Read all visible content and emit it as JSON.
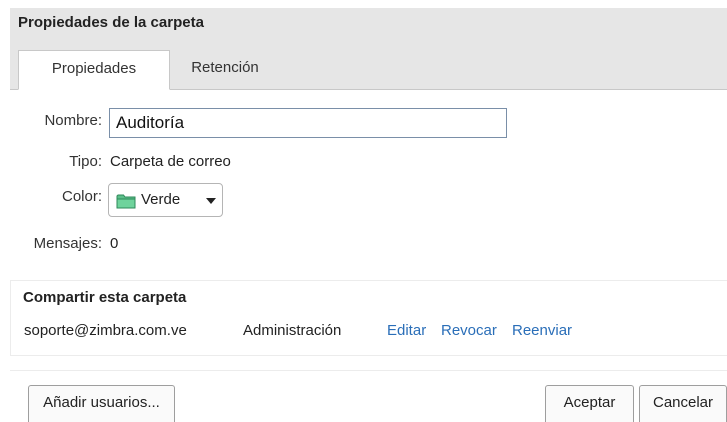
{
  "dialog": {
    "title": "Propiedades de la carpeta"
  },
  "tabs": [
    {
      "label": "Propiedades",
      "active": true
    },
    {
      "label": "Retención",
      "active": false
    }
  ],
  "form": {
    "name_label": "Nombre:",
    "name_value": "Auditoría",
    "type_label": "Tipo:",
    "type_value": "Carpeta de correo",
    "color_label": "Color:",
    "color_value": "Verde",
    "messages_label": "Mensajes:",
    "messages_value": "0"
  },
  "share": {
    "title": "Compartir esta carpeta",
    "rows": [
      {
        "user": "soporte@zimbra.com.ve",
        "role": "Administración",
        "actions": [
          "Editar",
          "Revocar",
          "Reenviar"
        ]
      }
    ]
  },
  "footer": {
    "add_users_label": "Añadir usuarios...",
    "accept_label": "Aceptar",
    "cancel_label": "Cancelar"
  },
  "colors": {
    "folder_green": "#5cbf8a",
    "link": "#2a6eb8",
    "tab_background": "#e6e6e6"
  },
  "icons": {
    "folder": "folder-icon",
    "dropdown": "chevron-down-icon"
  }
}
